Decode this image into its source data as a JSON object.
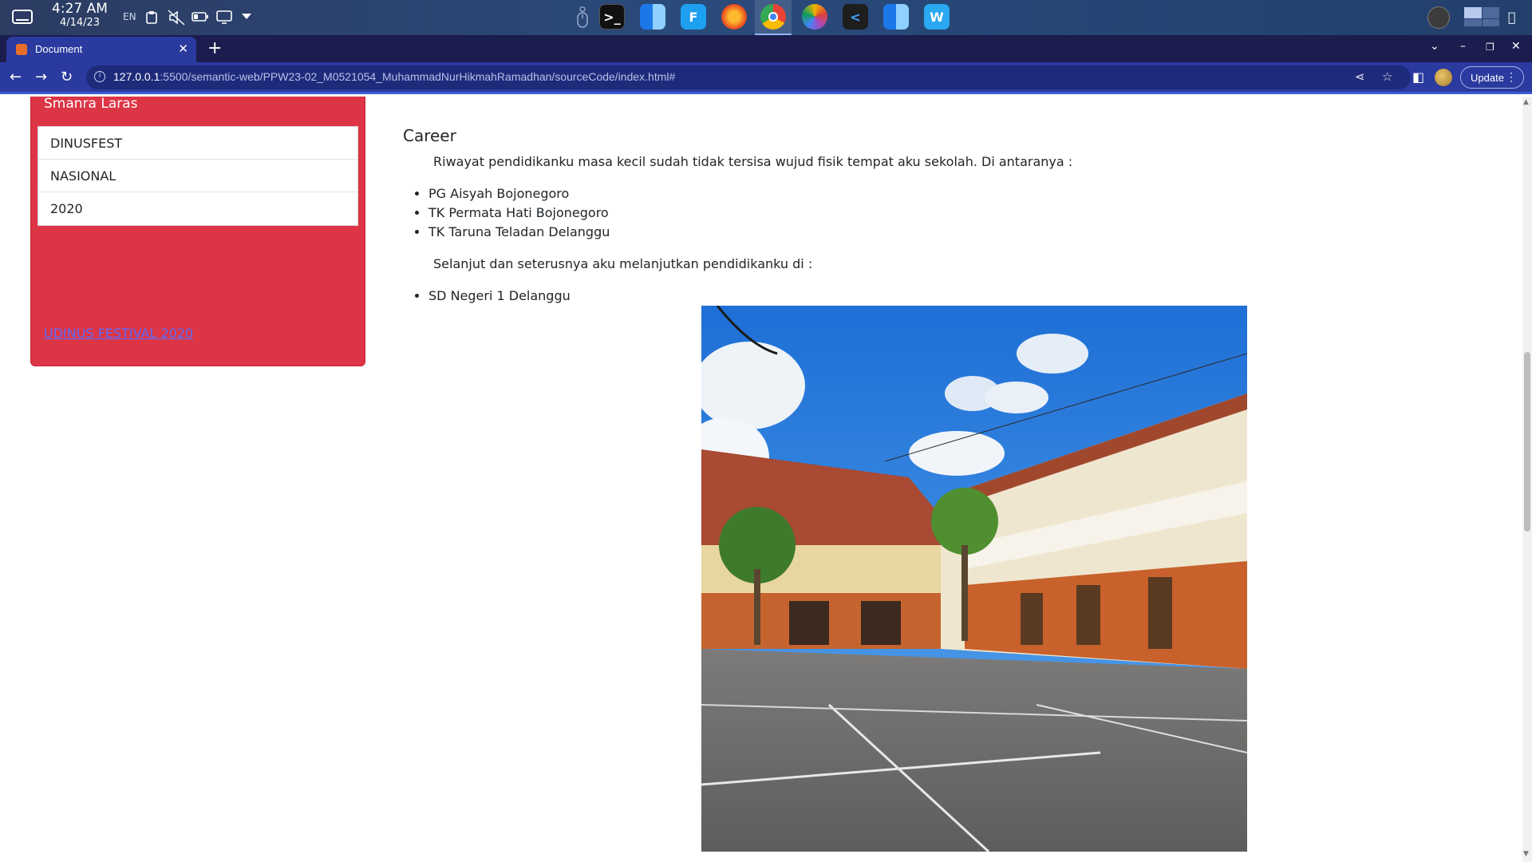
{
  "taskbar": {
    "time": "4:27 AM",
    "date": "4/14/23",
    "lang": "EN",
    "dock_apps": [
      "terminal",
      "finder",
      "flutter",
      "firefox",
      "chrome",
      "photos",
      "vscode",
      "finder-2",
      "wps"
    ]
  },
  "browser": {
    "tab_title": "Document",
    "url_host": "127.0.0.1",
    "url_rest": ":5500/semantic-web/PPW23-02_M0521054_MuhammadNurHikmahRamadhan/sourceCode/index.html#",
    "update_label": "Update"
  },
  "sidebar_card": {
    "heading": "Smanra Laras",
    "items": [
      "DINUSFEST",
      "NASIONAL",
      "2020"
    ],
    "link": "UDINUS FESTIVAL 2020",
    "color": "#dc3545"
  },
  "main": {
    "career_title": "Career",
    "intro": "Riwayat pendidikanku masa kecil sudah tidak tersisa wujud fisik tempat aku sekolah. Di antaranya :",
    "early_list": [
      "PG Aisyah Bojonegoro",
      "TK Permata Hati Bojonegoro",
      "TK Taruna Teladan Delanggu"
    ],
    "continuation": "Selanjut dan seterusnya aku melanjutkan pendidikanku di :",
    "school_list": [
      "SD Negeri 1 Delanggu"
    ]
  }
}
